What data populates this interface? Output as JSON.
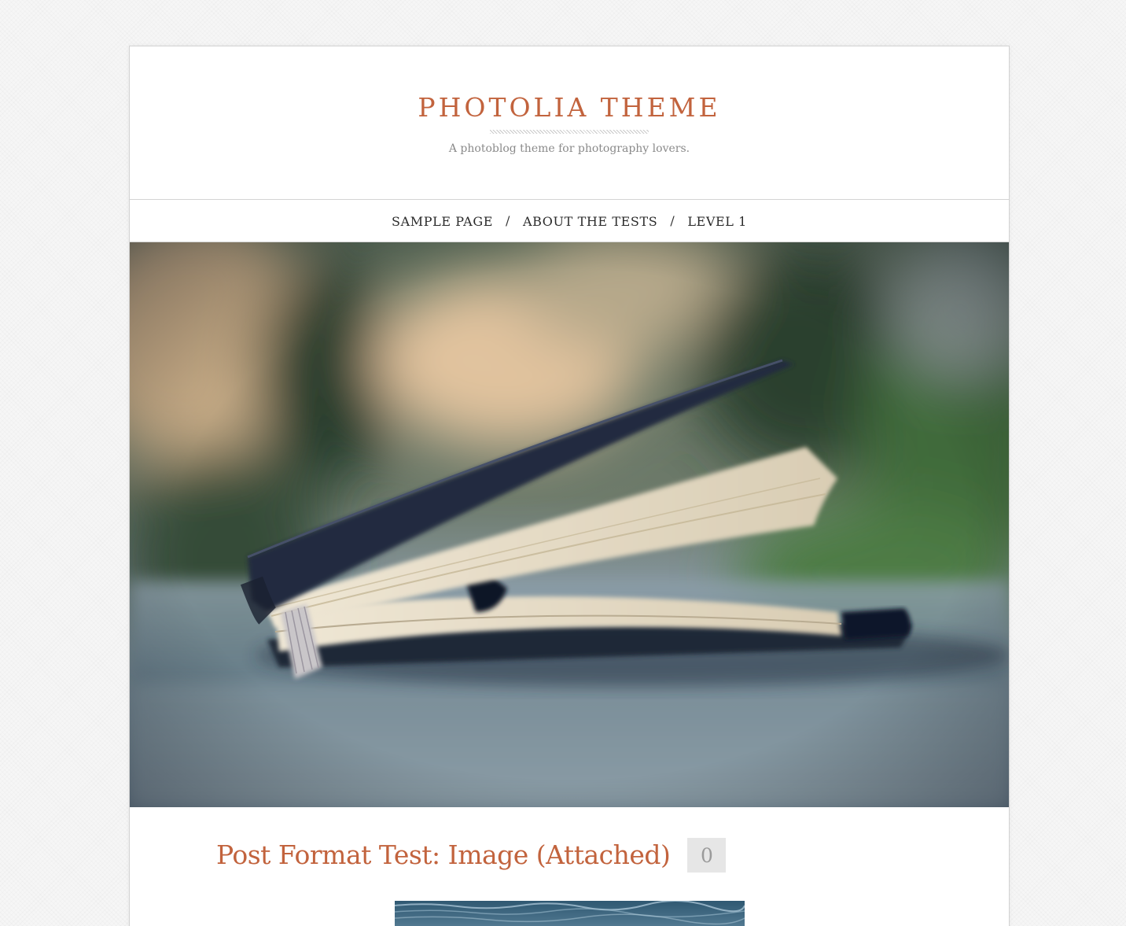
{
  "site": {
    "title": "PHOTOLIA THEME",
    "tagline": "A photoblog theme for photography lovers."
  },
  "nav": {
    "items": [
      {
        "label": "SAMPLE PAGE"
      },
      {
        "label": "ABOUT THE TESTS"
      },
      {
        "label": "LEVEL 1"
      }
    ],
    "separator": "/"
  },
  "hero": {
    "image": "notebook-photo"
  },
  "post": {
    "title": "Post Format Test: Image (Attached)",
    "comment_count": "0"
  },
  "colors": {
    "accent": "#c2633d",
    "tagline": "#8a8a8a",
    "badge_bg": "#e6e6e6"
  }
}
